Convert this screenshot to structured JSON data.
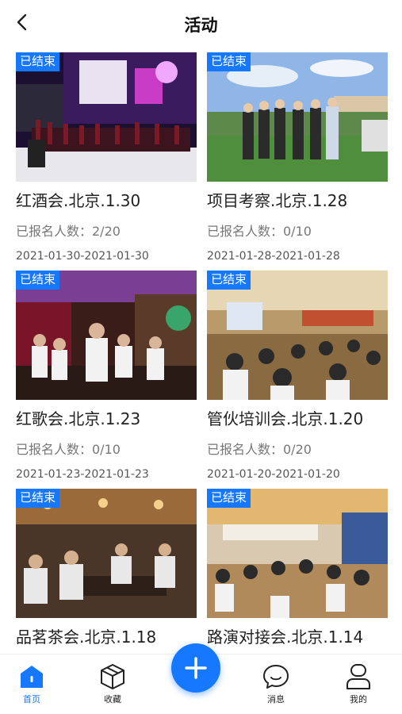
{
  "header": {
    "title": "活动"
  },
  "colors": {
    "accent": "#1677ff"
  },
  "activities": [
    {
      "badge": "已结束",
      "title": "红酒会.北京.1.30",
      "count": "已报名人数：2/20",
      "dates": "2021-01-30-2021-01-30"
    },
    {
      "badge": "已结束",
      "title": "项目考察.北京.1.28",
      "count": "已报名人数：0/10",
      "dates": "2021-01-28-2021-01-28"
    },
    {
      "badge": "已结束",
      "title": "红歌会.北京.1.23",
      "count": "已报名人数：0/10",
      "dates": "2021-01-23-2021-01-23"
    },
    {
      "badge": "已结束",
      "title": "管伙培训会.北京.1.20",
      "count": "已报名人数：0/20",
      "dates": "2021-01-20-2021-01-20"
    },
    {
      "badge": "已结束",
      "title": "品茗茶会.北京.1.18",
      "count": "",
      "dates": ""
    },
    {
      "badge": "已结束",
      "title": "路演对接会.北京.1.14",
      "count": "",
      "dates": ""
    }
  ],
  "tabbar": {
    "items": [
      {
        "label": "首页",
        "icon": "home-icon"
      },
      {
        "label": "收藏",
        "icon": "cube-icon"
      },
      {
        "label": "",
        "icon": "plus-icon"
      },
      {
        "label": "消息",
        "icon": "chat-icon"
      },
      {
        "label": "我的",
        "icon": "user-icon"
      }
    ]
  }
}
